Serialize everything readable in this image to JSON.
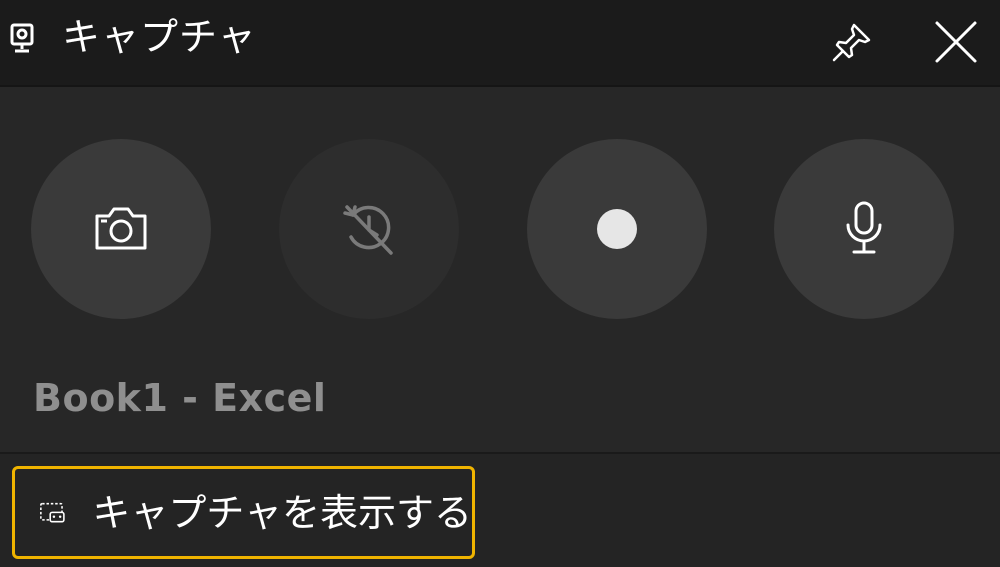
{
  "titlebar": {
    "title": "キャプチャ",
    "widget_icon": "capture-widget-icon",
    "pin_icon": "pin-icon",
    "close_icon": "close-icon"
  },
  "controls": {
    "buttons": [
      {
        "name": "take-screenshot",
        "icon": "camera-icon",
        "enabled": true
      },
      {
        "name": "record-last",
        "icon": "record-last-disabled-icon",
        "enabled": false
      },
      {
        "name": "start-recording",
        "icon": "record-dot-icon",
        "enabled": true
      },
      {
        "name": "microphone",
        "icon": "microphone-icon",
        "enabled": true
      }
    ],
    "app_name": "Book1 - Excel"
  },
  "footer": {
    "show_captures_label": "キャプチャを表示する",
    "show_captures_icon": "gallery-icon",
    "focus_color": "#f0b400"
  },
  "colors": {
    "titlebar_bg": "#1b1b1b",
    "panel_bg": "#272727",
    "button_bg": "#3a3a3a",
    "button_disabled_bg": "#2d2d2d",
    "app_name_text": "#8f8f8f"
  }
}
